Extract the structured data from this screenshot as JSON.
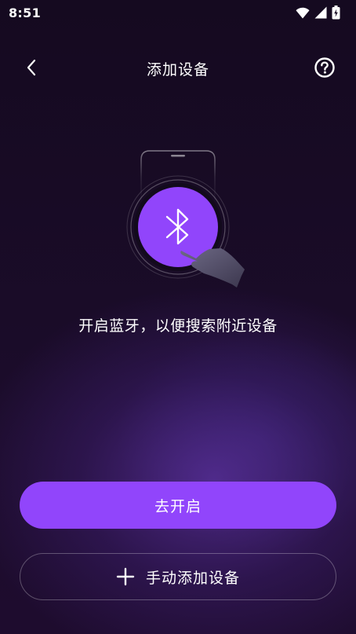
{
  "status_bar": {
    "time": "8:51",
    "icons": [
      "wifi-icon",
      "signal-icon",
      "battery-charging-icon"
    ]
  },
  "header": {
    "title": "添加设备",
    "back_icon": "chevron-left-icon",
    "help_icon": "help-circle-icon"
  },
  "illustration": {
    "icon": "bluetooth-icon",
    "accent_color": "#9145fb"
  },
  "prompt": "开启蓝牙，以便搜索附近设备",
  "actions": {
    "enable_label": "去开启",
    "manual_add_label": "手动添加设备",
    "manual_add_icon": "plus-icon"
  }
}
